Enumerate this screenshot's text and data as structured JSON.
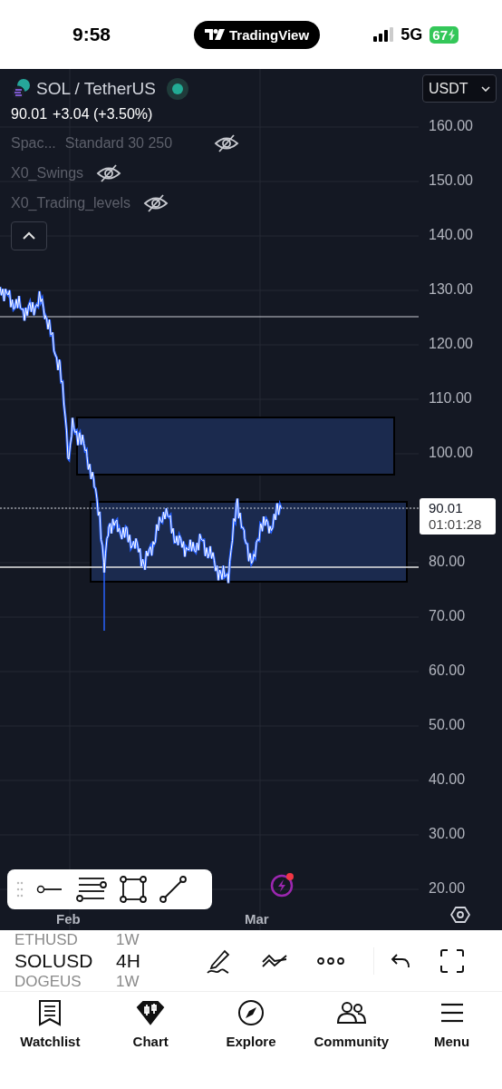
{
  "status_bar": {
    "time": "9:58",
    "app_badge": "TradingView",
    "network": "5G",
    "battery": "67"
  },
  "chart": {
    "symbol": "SOL / TetherUS",
    "market_open": true,
    "last_price": "90.01",
    "change": "+3.04 (+3.50%)",
    "currency": "USDT",
    "indicators": [
      {
        "name": "Spac...",
        "settings": "Standard 30 250",
        "hidden": true
      },
      {
        "name": "X0_Swings",
        "hidden": true
      },
      {
        "name": "X0_Trading_levels",
        "hidden": true
      }
    ],
    "price_axis": [
      "160.00",
      "150.00",
      "140.00",
      "130.00",
      "120.00",
      "110.00",
      "100.00",
      "80.00",
      "70.00",
      "60.00",
      "50.00",
      "40.00",
      "30.00",
      "20.00"
    ],
    "time_axis": [
      "Feb",
      "Mar"
    ],
    "price_label": {
      "price": "90.01",
      "countdown": "01:01:28"
    }
  },
  "symbol_picker": [
    {
      "symbol": "ETHUSD",
      "interval": "1W",
      "selected": false
    },
    {
      "symbol": "SOLUSD",
      "interval": "4H",
      "selected": true
    },
    {
      "symbol": "DOGEUS",
      "interval": "1W",
      "selected": false
    }
  ],
  "tabs": [
    {
      "label": "Watchlist"
    },
    {
      "label": "Chart"
    },
    {
      "label": "Explore"
    },
    {
      "label": "Community"
    },
    {
      "label": "Menu"
    }
  ]
}
